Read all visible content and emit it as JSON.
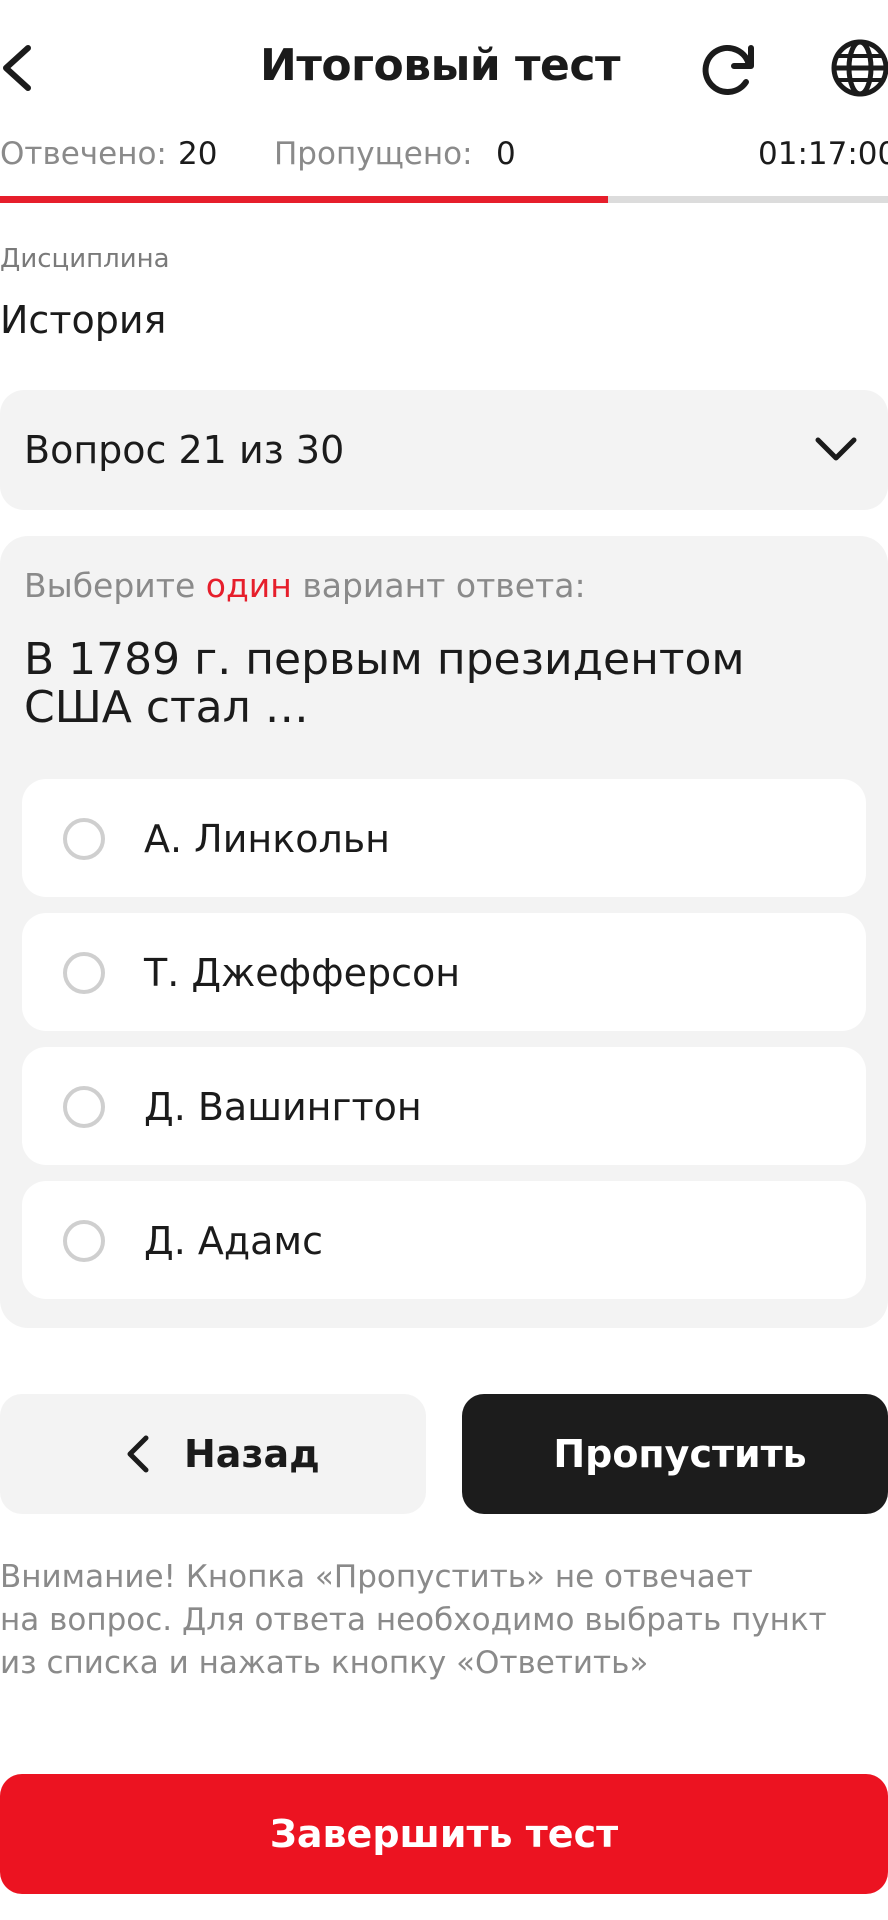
{
  "header": {
    "back_icon": "chevron-left-icon",
    "title": "Итоговый тест",
    "refresh_icon": "refresh-icon",
    "language_icon": "globe-icon"
  },
  "stats": {
    "answered_label": "Отвечено:",
    "answered_value": "20",
    "skipped_label": "Пропущено:",
    "skipped_value": "0",
    "timer": "01:17:00"
  },
  "progress": {
    "fraction": 0.685,
    "fill_color": "#e61e2b",
    "track_color": "#dcdcdc"
  },
  "discipline": {
    "label": "Дисциплина",
    "value": "История"
  },
  "question_selector": {
    "label": "Вопрос 21 из 30",
    "icon": "chevron-down-icon"
  },
  "question": {
    "instruction_prefix": "Выберите",
    "instruction_accent": "один",
    "instruction_suffix": "вариант ответа:",
    "text": "В 1789 г. первым президентом США стал …",
    "options": [
      {
        "label": "А. Линкольн"
      },
      {
        "label": "Т. Джефферсон"
      },
      {
        "label": "Д. Вашингтон"
      },
      {
        "label": "Д. Адамс"
      }
    ]
  },
  "buttons": {
    "back_label": "Назад",
    "skip_label": "Пропустить",
    "finish_label": "Завершить тест"
  },
  "note": {
    "line1": "Внимание! Кнопка «Пропустить» не отвечает",
    "line2": "на вопрос. Для ответа необходимо выбрать пункт",
    "line3": "из списка и нажать кнопку «Ответить»"
  },
  "colors": {
    "accent": "#e61e2b",
    "finish_button": "#ec1321",
    "dark_button": "#1c1c1c"
  }
}
